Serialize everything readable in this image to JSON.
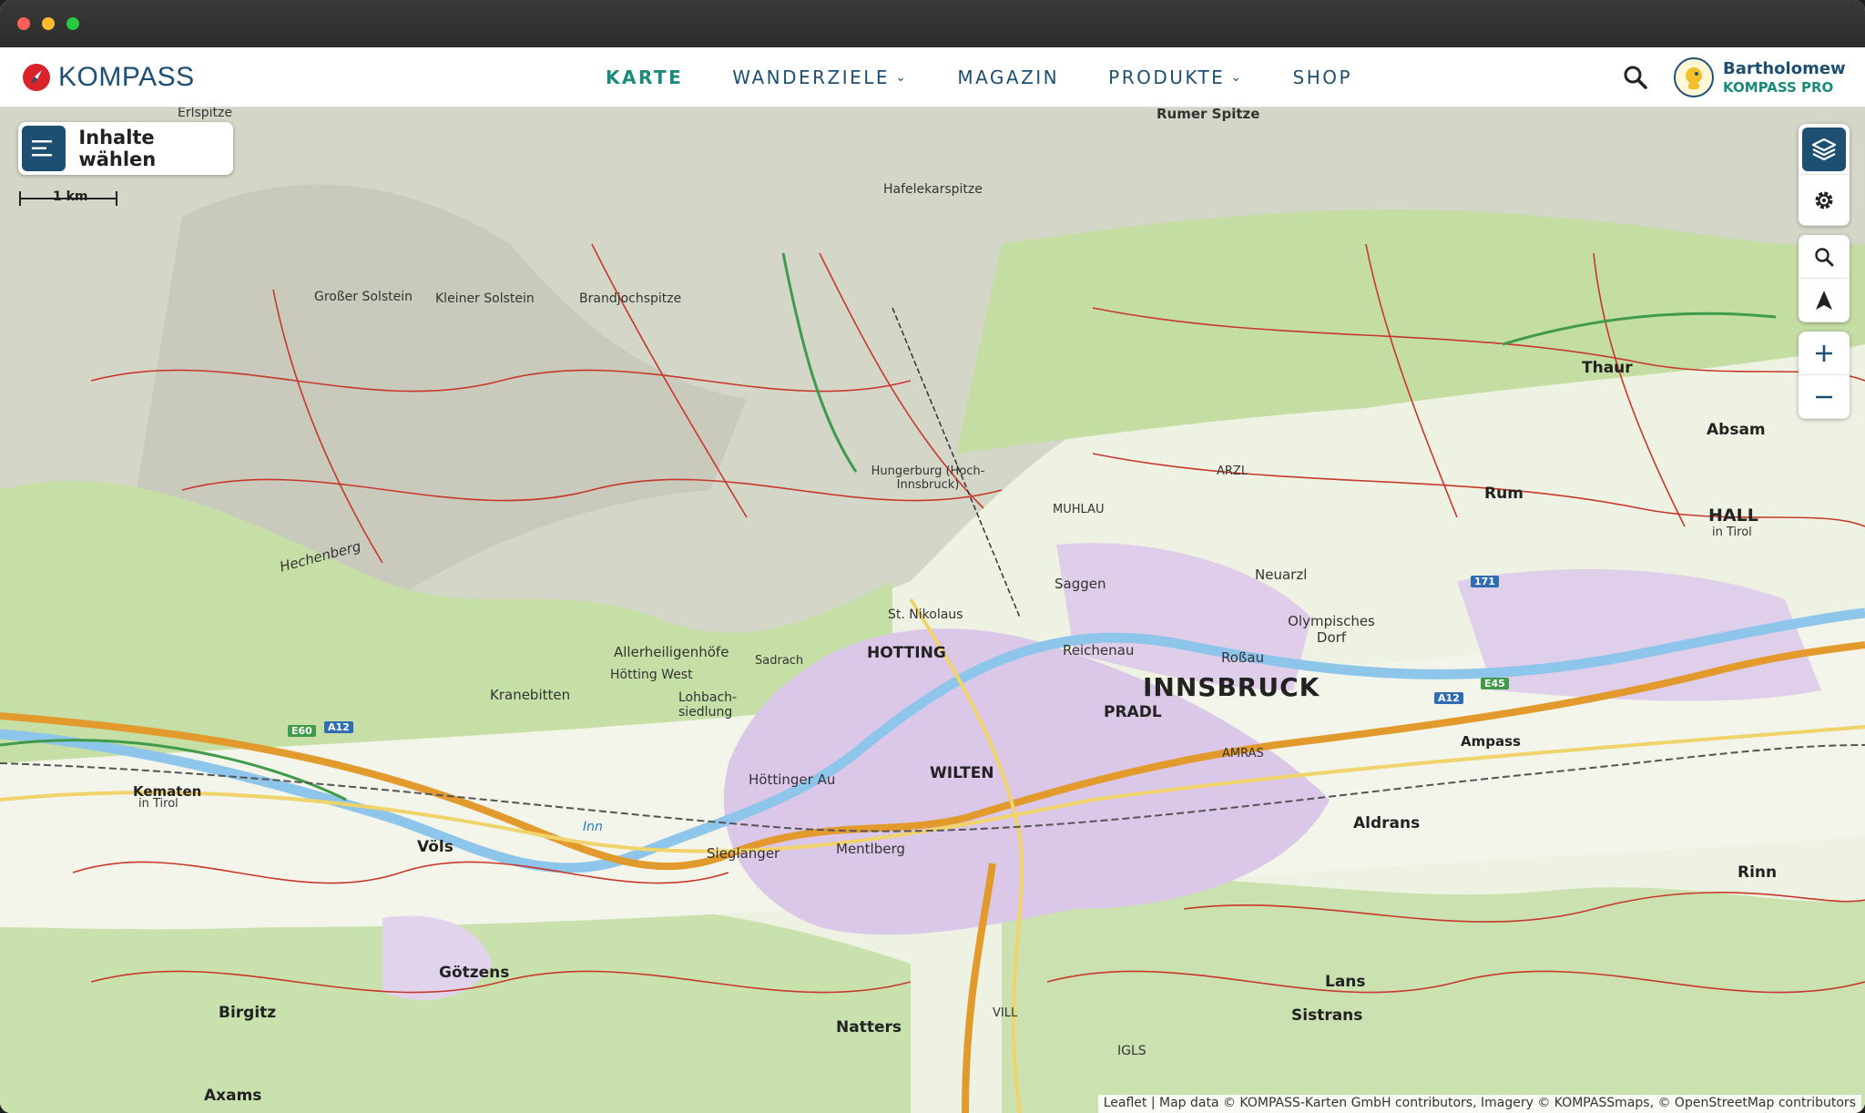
{
  "brand": {
    "name": "KOMPASS"
  },
  "nav": {
    "items": [
      {
        "label": "KARTE",
        "active": true,
        "dropdown": false
      },
      {
        "label": "WANDERZIELE",
        "active": false,
        "dropdown": true
      },
      {
        "label": "MAGAZIN",
        "active": false,
        "dropdown": false
      },
      {
        "label": "PRODUKTE",
        "active": false,
        "dropdown": true
      },
      {
        "label": "SHOP",
        "active": false,
        "dropdown": false
      }
    ],
    "search_icon": "search-icon"
  },
  "user": {
    "name": "Bartholomew",
    "tier": "KOMPASS PRO"
  },
  "map": {
    "content_button_label": "Inhalte wählen",
    "scale_label": "1 km",
    "attribution": "Leaflet | Map data © KOMPASS-Karten GmbH contributors, Imagery © KOMPASSmaps, © OpenStreetMap contributors",
    "places": {
      "innsbruck": "INNSBRUCK",
      "hall": "HALL",
      "hall_sub": "in Tirol",
      "hotting": "HOTTING",
      "pradl": "PRADL",
      "wilten": "WILTEN",
      "arzl": "ARZL",
      "muhlau": "MUHLAU",
      "thaur": "Thaur",
      "absam": "Absam",
      "rum": "Rum",
      "neuarzl": "Neuarzl",
      "olympisches_dorf": "Olympisches Dorf",
      "rossau": "Roßau",
      "ampass": "Ampass",
      "aldrans": "Aldrans",
      "lans": "Lans",
      "sistrans": "Sistrans",
      "rinn": "Rinn",
      "natters": "Natters",
      "gotzens": "Götzens",
      "birgitz": "Birgitz",
      "axams": "Axams",
      "vols": "Völs",
      "kematen": "Kematen",
      "kematen_sub": "in Tirol",
      "hottinger_au": "Höttinger Au",
      "sieglanger": "Sieglanger",
      "mentlberg": "Mentlberg",
      "kranebitten": "Kranebitten",
      "allerheiligenhofe": "Allerheiligenhöfe",
      "sadrach": "Sadrach",
      "st_nikolaus": "St. Nikolaus",
      "saggen": "Saggen",
      "reichenau": "Reichenau",
      "amras": "AMRAS",
      "hottinger_west": "Hötting West",
      "lohbach": "Lohbach-siedlung",
      "hungerburg": "Hungerburg (Hoch-Innsbruck)",
      "igls": "IGLS",
      "vill": "VILL"
    },
    "peaks": {
      "hafelekar": "Hafelekarspitze",
      "grosser_solstein": "Großer Solstein",
      "kleiner_solstein": "Kleiner Solstein",
      "brandjochspitze": "Brandjochspitze",
      "erlspitze": "Erlspitze",
      "hechenberg": "Hechenberg",
      "rumer_spitze": "Rumer Spitze"
    },
    "river": "Inn",
    "roads": [
      "A12",
      "A12",
      "E60",
      "171",
      "E45"
    ]
  },
  "colors": {
    "brand_blue": "#1d4f73",
    "accent_teal": "#1a8a7a",
    "forest": "#cfe3b3",
    "urban": "#d9c6e6",
    "river": "#8ec5ea",
    "motorway": "#e29a2c",
    "trail": "#c8372b"
  }
}
